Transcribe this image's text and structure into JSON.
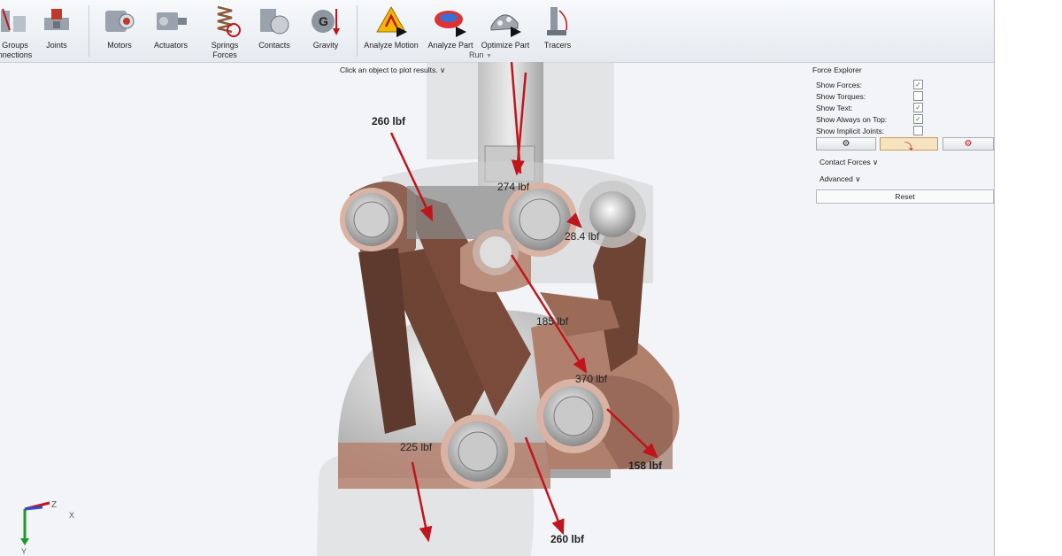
{
  "ribbon": {
    "buttons": [
      {
        "label": "Groups",
        "label2": "nnections"
      },
      {
        "label": "Joints"
      },
      {
        "label": "Motors"
      },
      {
        "label": "Actuators"
      },
      {
        "label": "Springs",
        "label2": "Forces"
      },
      {
        "label": "Contacts"
      },
      {
        "label": "Gravity"
      },
      {
        "label": "Analyze Motion"
      },
      {
        "label": "Analyze Part"
      },
      {
        "label": "Optimize Part"
      },
      {
        "label": "Tracers"
      }
    ],
    "run_group_label": "Run"
  },
  "viewport": {
    "hint": "Click an object to plot results.",
    "force_labels": [
      "260 lbf",
      "274 lbf",
      "28.4 lbf",
      "185 lbf",
      "370 lbf",
      "158 lbf",
      "225 lbf",
      "260 lbf"
    ],
    "axes": {
      "z": "Z",
      "x": "X",
      "y": "Y"
    }
  },
  "force_explorer": {
    "title": "Force Explorer",
    "options": [
      {
        "label": "Show Forces:",
        "checked": "✓"
      },
      {
        "label": "Show Torques:",
        "checked": ""
      },
      {
        "label": "Show Text:",
        "checked": "✓"
      },
      {
        "label": "Show Always on Top:",
        "checked": "✓"
      },
      {
        "label": "Show Implicit Joints:",
        "checked": ""
      }
    ],
    "contact_forces": "Contact Forces",
    "advanced": "Advanced",
    "reset": "Reset"
  },
  "colors": {
    "force_arrow": "#c0151c",
    "lattice": "#7a4a3a",
    "accent_check": "#2f7a1f",
    "selected_tool": "#f6e3c0"
  }
}
